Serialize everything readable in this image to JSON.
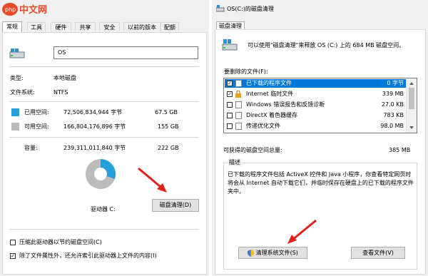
{
  "watermark": {
    "text": "php 中文网"
  },
  "left": {
    "tabs": [
      "常规",
      "工具",
      "硬件",
      "共享",
      "安全",
      "以前的版本",
      "配额"
    ],
    "drive_name": "OS",
    "type_label": "类型:",
    "type_value": "本地磁盘",
    "fs_label": "文件系统:",
    "fs_value": "NTFS",
    "used_label": "已用空间:",
    "used_bytes": "72,506,834,944 字节",
    "used_gb": "67.5 GB",
    "free_label": "可用空间:",
    "free_bytes": "166,804,176,896 字节",
    "free_gb": "155 GB",
    "cap_label": "容量:",
    "cap_bytes": "239,311,011,840 字节",
    "cap_gb": "222 GB",
    "used_fraction": 0.303,
    "drive_label": "驱动器 C:",
    "cleanup_button": "磁盘清理(D)",
    "compress_label": "压缩此驱动器以节约磁盘空间(C)",
    "index_label": "除了文件属性外，还允许索引此驱动器上文件的内容(I)",
    "compress_checked": false,
    "index_checked": true,
    "colors": {
      "used": "#26a0da",
      "free": "#bcbcbc"
    }
  },
  "right": {
    "title": "OS(C:)的磁盘清理",
    "tab": "磁盘清理",
    "intro": "可以使用\"磁盘清理\"来释放 OS (C:) 上的 684 MB 磁盘空间。",
    "list_label": "要删除的文件(F):",
    "items": [
      {
        "name": "已下载的程序文件",
        "size": "0 字节",
        "checked": true,
        "selected": true
      },
      {
        "name": "Internet 临时文件",
        "size": "339 MB",
        "checked": true,
        "selected": false
      },
      {
        "name": "Windows 错误报告和反馈诊断",
        "size": "27.0 KB",
        "checked": false,
        "selected": false
      },
      {
        "name": "DirectX 着色器缓存",
        "size": "783 KB",
        "checked": false,
        "selected": false
      },
      {
        "name": "传递优化文件",
        "size": "98.0 MB",
        "checked": false,
        "selected": false
      }
    ],
    "total_label": "可获得的磁盘空间总量:",
    "total_value": "385 MB",
    "desc_label": "描述",
    "desc_text": "已下载的程序文件包括 ActiveX 控件和 Java 小程序，你查看特定网页时将会从 Internet 自动下载它们，并临时保存在硬盘上的已下载的程序文件夹中。",
    "cleanup_system_button": "清理系统文件(S)",
    "view_files_button": "查看文件(V)"
  }
}
